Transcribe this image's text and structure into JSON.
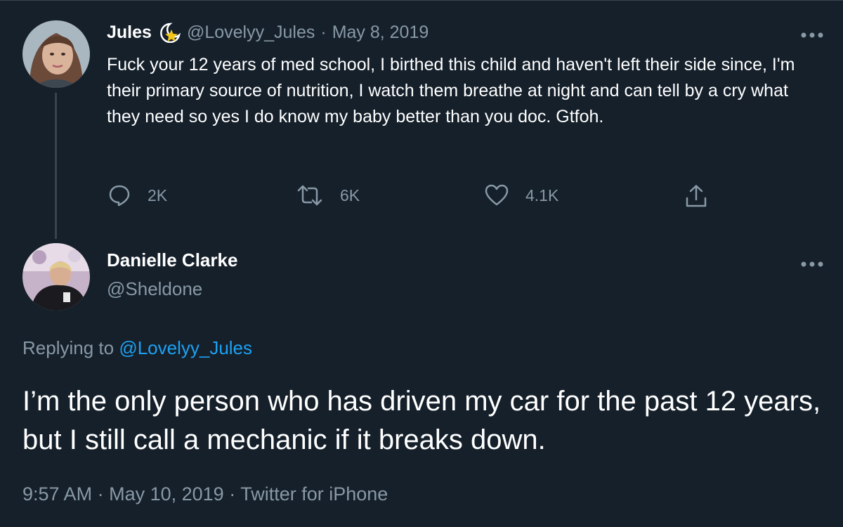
{
  "original_tweet": {
    "display_name": "Jules",
    "badge_icon": "star-moon-emoji-icon",
    "handle": "@Lovelyy_Jules",
    "separator": "·",
    "date": "May 8, 2019",
    "text": "Fuck your 12 years of med school, I birthed this child and haven't left their side since, I'm their primary source of nutrition, I watch them breathe at night and can tell by a cry what they need so yes I do know my baby better than you doc. Gtfoh.",
    "actions": {
      "replies": "2K",
      "retweets": "6K",
      "likes": "4.1K"
    }
  },
  "reply_tweet": {
    "display_name": "Danielle Clarke",
    "handle": "@Sheldone",
    "replying_prefix": "Replying to",
    "replying_mention": "@Lovelyy_Jules",
    "text": "I’m the only person who has driven my car for the past 12 years, but I still call a mechanic if it breaks down.",
    "time": "9:57 AM",
    "separator": "·",
    "date": "May 10, 2019",
    "source": "Twitter for iPhone"
  },
  "colors": {
    "background": "#15202b",
    "muted": "#8899a6",
    "link": "#1da1f2",
    "border": "#38444d"
  }
}
